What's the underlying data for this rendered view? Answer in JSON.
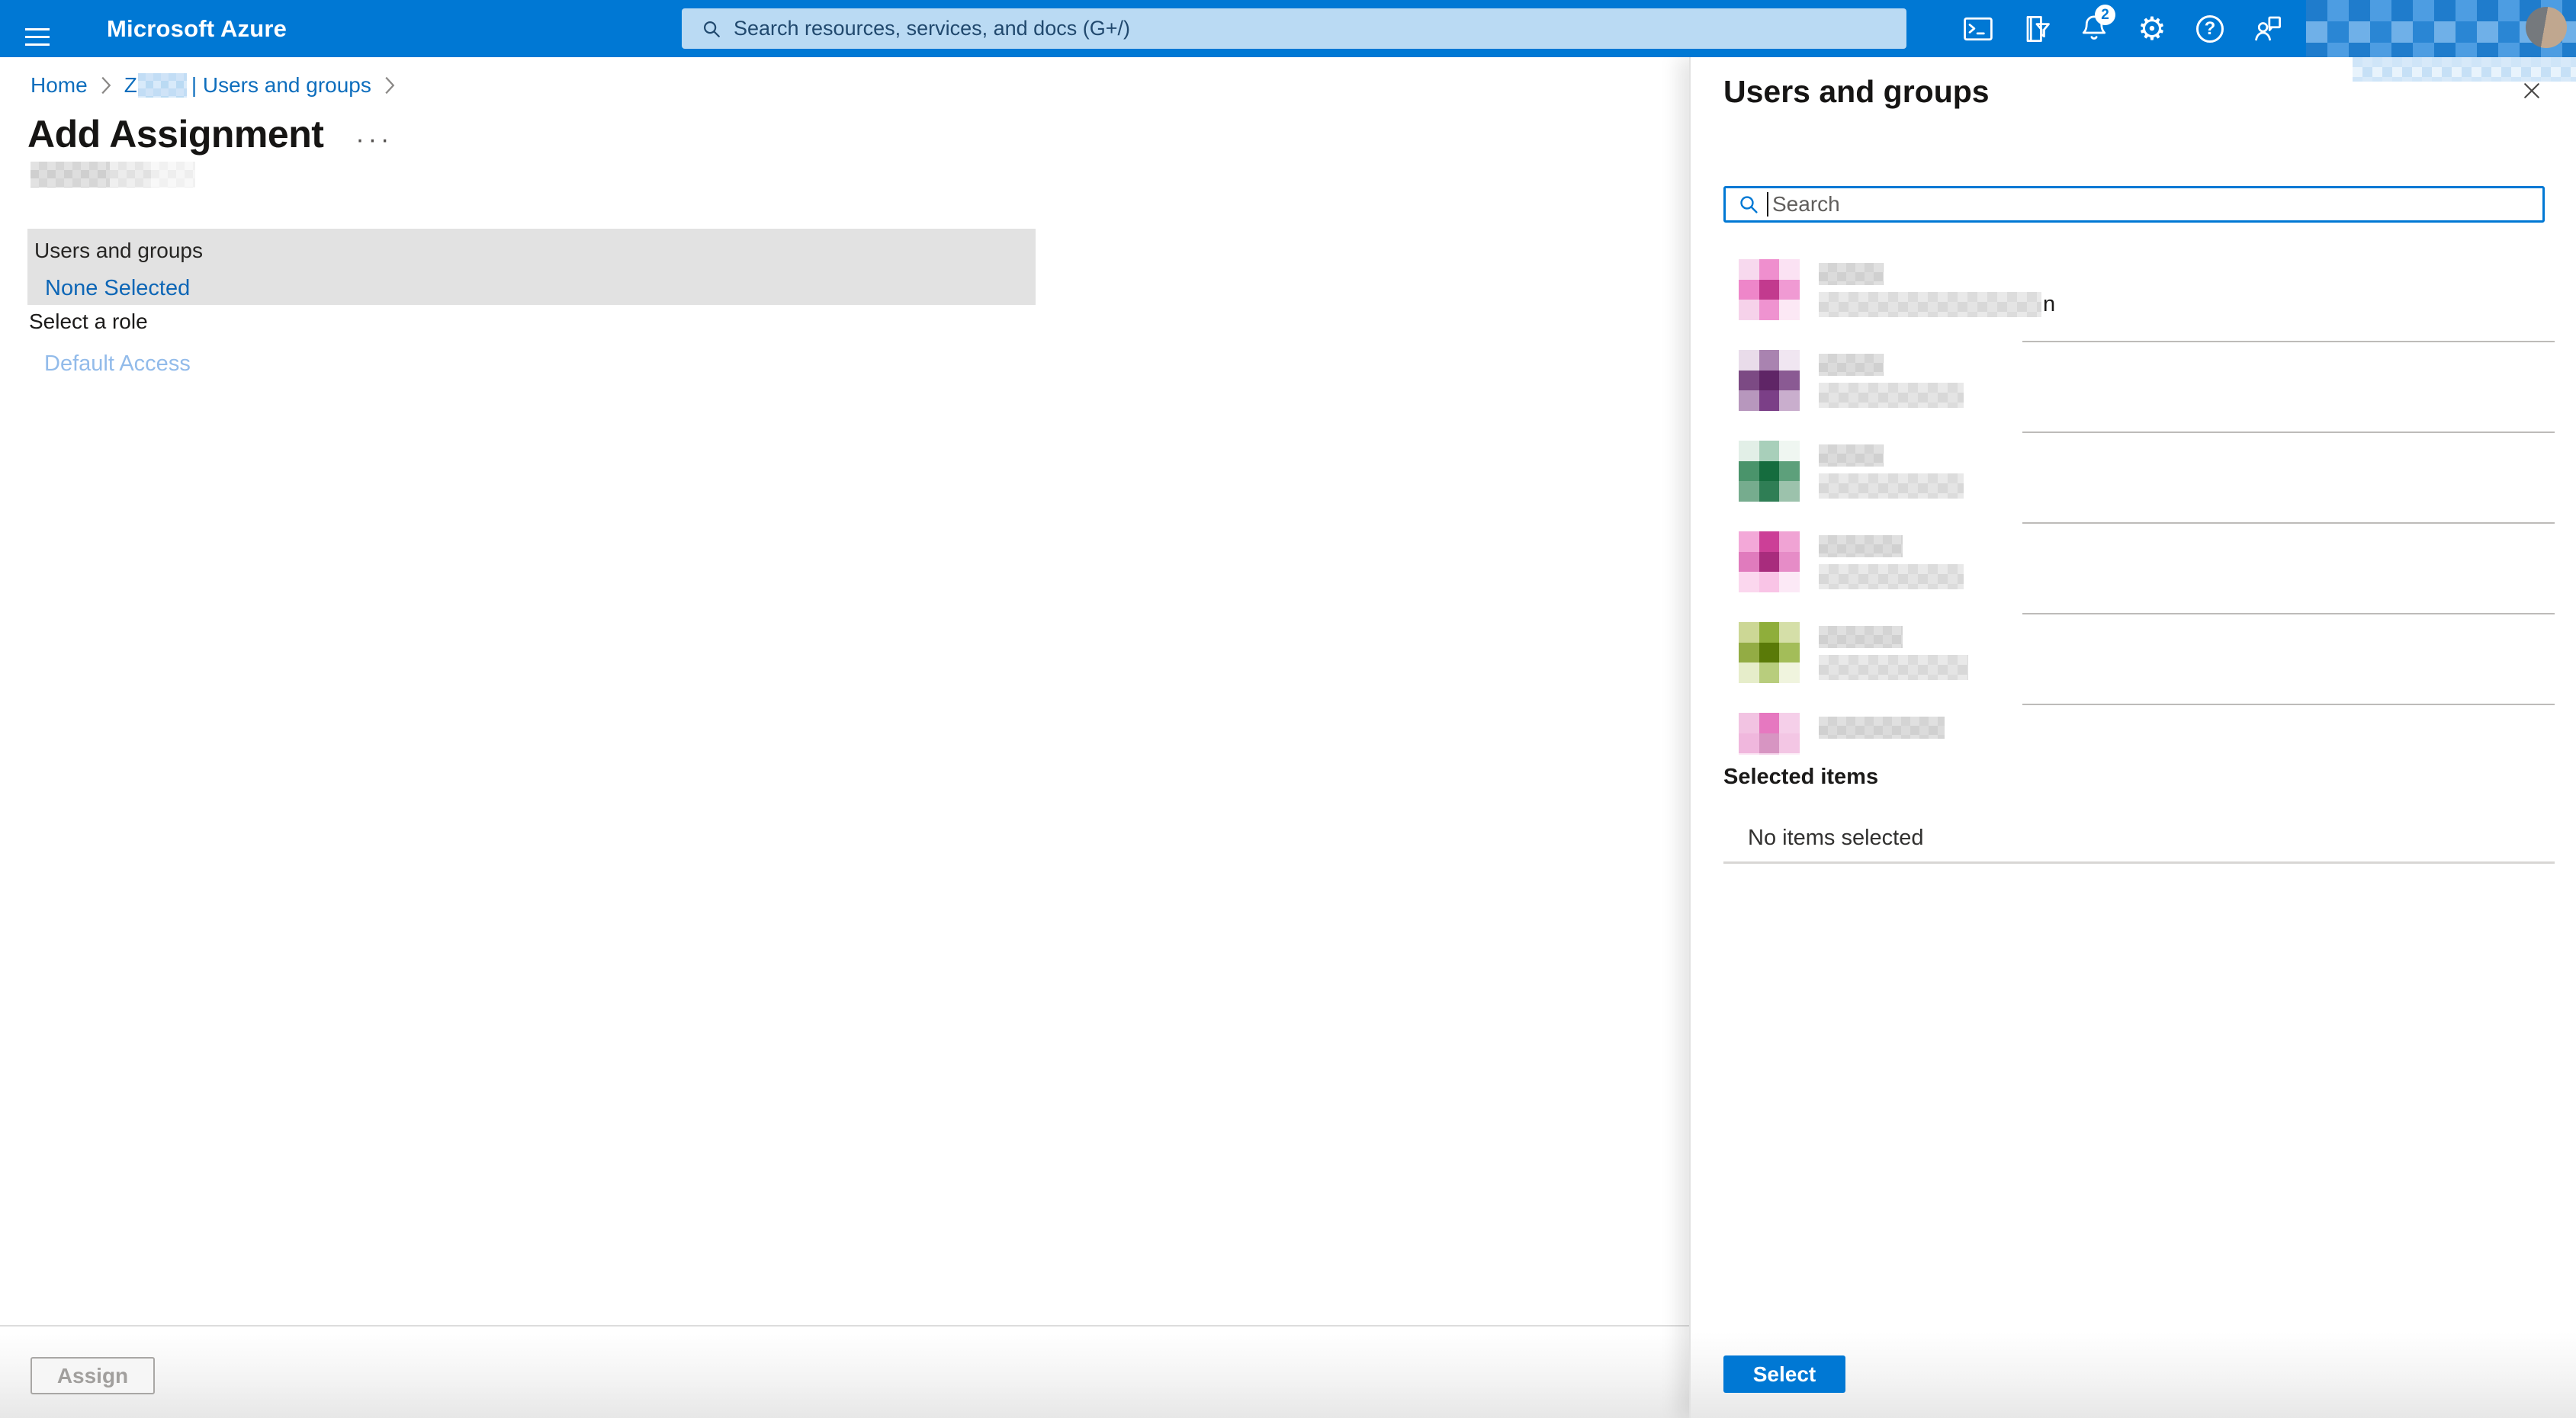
{
  "topbar": {
    "brand": "Microsoft Azure",
    "search_placeholder": "Search resources, services, and docs (G+/)",
    "notification_badge": "2",
    "gear_glyph": "⚙",
    "help_glyph": "?"
  },
  "breadcrumb": {
    "home": "Home",
    "current_prefix": "Z",
    "current_suffix": "| Users and groups"
  },
  "page": {
    "title": "Add Assignment",
    "more_options": "···"
  },
  "form": {
    "users_groups_label": "Users and groups",
    "users_groups_value": "None Selected",
    "role_label": "Select a role",
    "role_value": "Default Access",
    "assign_button": "Assign"
  },
  "panel": {
    "title": "Users and groups",
    "search_placeholder": "Search",
    "selected_items_heading": "Selected items",
    "no_items_text": "No items selected",
    "select_button": "Select",
    "users": [
      {
        "avatar_colors": [
          "#f7d9ee",
          "#ef8fce",
          "#fbe2f3",
          "#ee86c9",
          "#c23a8e",
          "#f09ad3",
          "#f6d2ea",
          "#ef93d0",
          "#fce8f5"
        ],
        "email_remnant": "n"
      },
      {
        "avatar_colors": [
          "#e9dcea",
          "#a983b0",
          "#f0e6f1",
          "#7c4a84",
          "#5f2566",
          "#8a5a93",
          "#b797bd",
          "#7b3f87",
          "#c9aecd"
        ]
      },
      {
        "avatar_colors": [
          "#e2efe7",
          "#a8cfba",
          "#eff6f1",
          "#4a946b",
          "#156c3e",
          "#5da07b",
          "#76ac8e",
          "#2f7e55",
          "#9cc2ac"
        ]
      },
      {
        "avatar_colors": [
          "#f3a8d8",
          "#cc3f97",
          "#f0a3d4",
          "#e07bbd",
          "#a82c7d",
          "#e68cc7",
          "#fbd7ee",
          "#f9c4e6",
          "#fce9f6"
        ]
      },
      {
        "avatar_colors": [
          "#ccd795",
          "#8fae3b",
          "#d5dfa8",
          "#93ac44",
          "#5a7a08",
          "#a3bd59",
          "#e6edca",
          "#b8cd7d",
          "#f0f4de"
        ]
      },
      {
        "avatar_colors": [
          "#f2c3e2",
          "#e678c0",
          "#f5cfe9",
          "#f0b7dd",
          "#d795c2",
          "#f3c6e4",
          "#fbe4f3",
          "#f5d3ea",
          "#fdf0f8"
        ]
      }
    ]
  },
  "colors": {
    "brand_blue": "#0078d4",
    "link_blue": "#0e68b8",
    "disabled_link": "#92bbea",
    "field_box_bg": "#e2e2e2",
    "disabled_button_text": "#a19f9d"
  }
}
